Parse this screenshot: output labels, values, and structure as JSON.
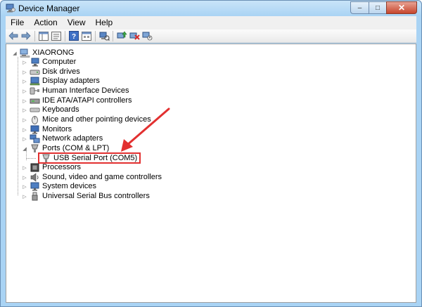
{
  "window": {
    "title": "Device Manager",
    "minimize": "–",
    "maximize": "□",
    "close": "✕"
  },
  "menu": [
    "File",
    "Action",
    "View",
    "Help"
  ],
  "tree": {
    "root": "XIAORONG",
    "items": [
      "Computer",
      "Disk drives",
      "Display adapters",
      "Human Interface Devices",
      "IDE ATA/ATAPI controllers",
      "Keyboards",
      "Mice and other pointing devices",
      "Monitors",
      "Network adapters",
      "Ports (COM & LPT)",
      "USB Serial Port (COM5)",
      "Processors",
      "Sound, video and game controllers",
      "System devices",
      "Universal Serial Bus controllers"
    ]
  },
  "colors": {
    "annotation": "#e23030"
  }
}
